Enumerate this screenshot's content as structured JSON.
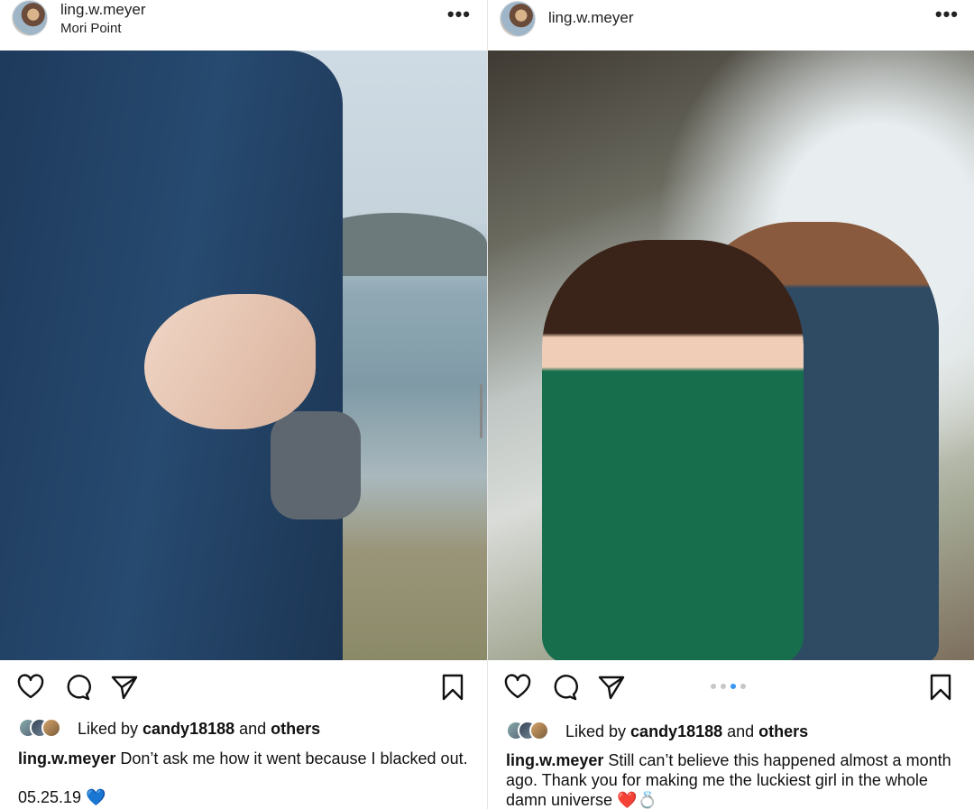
{
  "posts": [
    {
      "username": "ling.w.meyer",
      "location": "Mori Point",
      "liked_by_prefix": "Liked by ",
      "liked_by_user": "candy18188",
      "liked_by_and": " and ",
      "liked_by_others": "others",
      "caption_user": "ling.w.meyer",
      "caption_text": " Don’t ask me how it went because I blacked out.",
      "date": "05.25.19",
      "emoji": "💙"
    },
    {
      "username": "ling.w.meyer",
      "location": "",
      "liked_by_prefix": "Liked by ",
      "liked_by_user": "candy18188",
      "liked_by_and": " and ",
      "liked_by_others": "others",
      "caption_user": "ling.w.meyer",
      "caption_text": " Still can’t believe this happened almost a month ago. Thank you for making me the luckiest girl in the whole damn universe ❤️💍",
      "carousel": {
        "count": 4,
        "active_index": 2
      }
    }
  ],
  "icons": [
    "heart-icon",
    "comment-icon",
    "share-icon",
    "bookmark-icon",
    "more-icon"
  ],
  "colors": {
    "accent_dot": "#3897f0",
    "text": "#111111"
  }
}
